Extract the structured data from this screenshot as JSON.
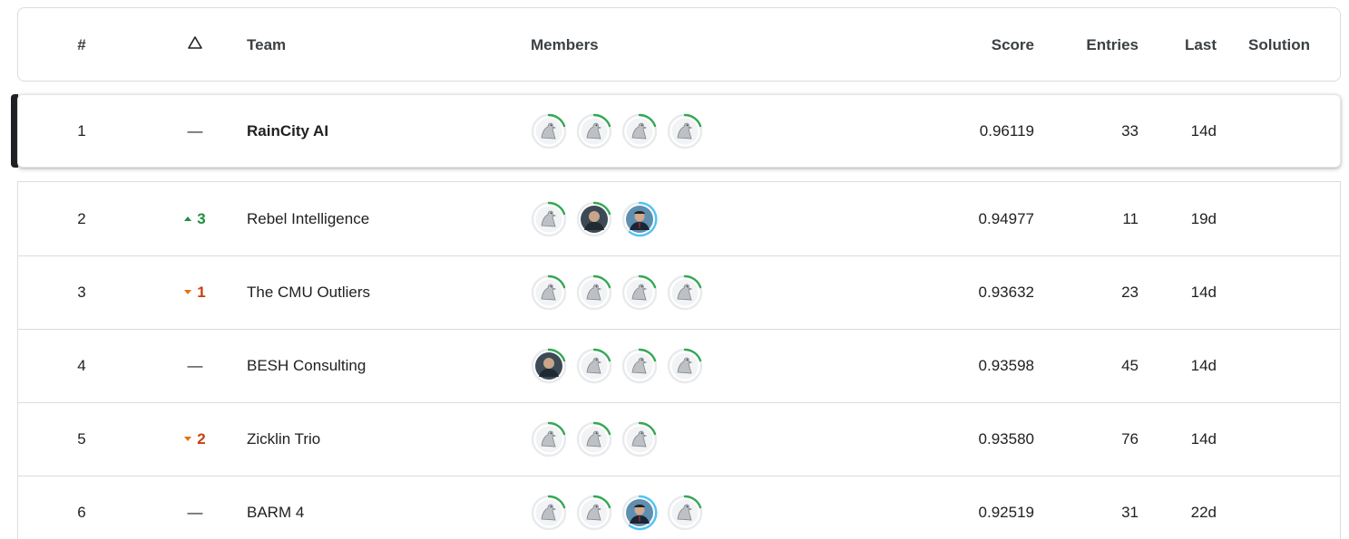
{
  "columns": {
    "rank": "#",
    "delta_icon": "delta-triangle-icon",
    "team": "Team",
    "members": "Members",
    "score": "Score",
    "entries": "Entries",
    "last": "Last",
    "solution": "Solution"
  },
  "colors": {
    "up": "#1e8e3e",
    "down": "#c5410f",
    "ring_green": "#34a853",
    "ring_blue": "#4fc3f7"
  },
  "rows": [
    {
      "rank": "1",
      "delta": "—",
      "delta_dir": "none",
      "team": "RainCity AI",
      "score": "0.96119",
      "entries": "33",
      "last": "14d",
      "members": [
        "default-avatar",
        "default-avatar",
        "default-avatar",
        "default-avatar"
      ]
    },
    {
      "rank": "2",
      "delta": "3",
      "delta_dir": "up",
      "team": "Rebel Intelligence",
      "score": "0.94977",
      "entries": "11",
      "last": "19d",
      "members": [
        "default-avatar",
        "photo-avatar",
        "photo-avatar-blue"
      ]
    },
    {
      "rank": "3",
      "delta": "1",
      "delta_dir": "down",
      "team": "The CMU Outliers",
      "score": "0.93632",
      "entries": "23",
      "last": "14d",
      "members": [
        "default-avatar",
        "default-avatar",
        "default-avatar",
        "default-avatar"
      ]
    },
    {
      "rank": "4",
      "delta": "—",
      "delta_dir": "none",
      "team": "BESH Consulting",
      "score": "0.93598",
      "entries": "45",
      "last": "14d",
      "members": [
        "photo-avatar",
        "default-avatar",
        "default-avatar",
        "default-avatar"
      ]
    },
    {
      "rank": "5",
      "delta": "2",
      "delta_dir": "down",
      "team": "Zicklin Trio",
      "score": "0.93580",
      "entries": "76",
      "last": "14d",
      "members": [
        "default-avatar",
        "default-avatar",
        "default-avatar"
      ]
    },
    {
      "rank": "6",
      "delta": "—",
      "delta_dir": "none",
      "team": "BARM 4",
      "score": "0.92519",
      "entries": "31",
      "last": "22d",
      "members": [
        "default-avatar",
        "default-avatar",
        "photo-avatar-blue",
        "default-avatar"
      ]
    }
  ]
}
